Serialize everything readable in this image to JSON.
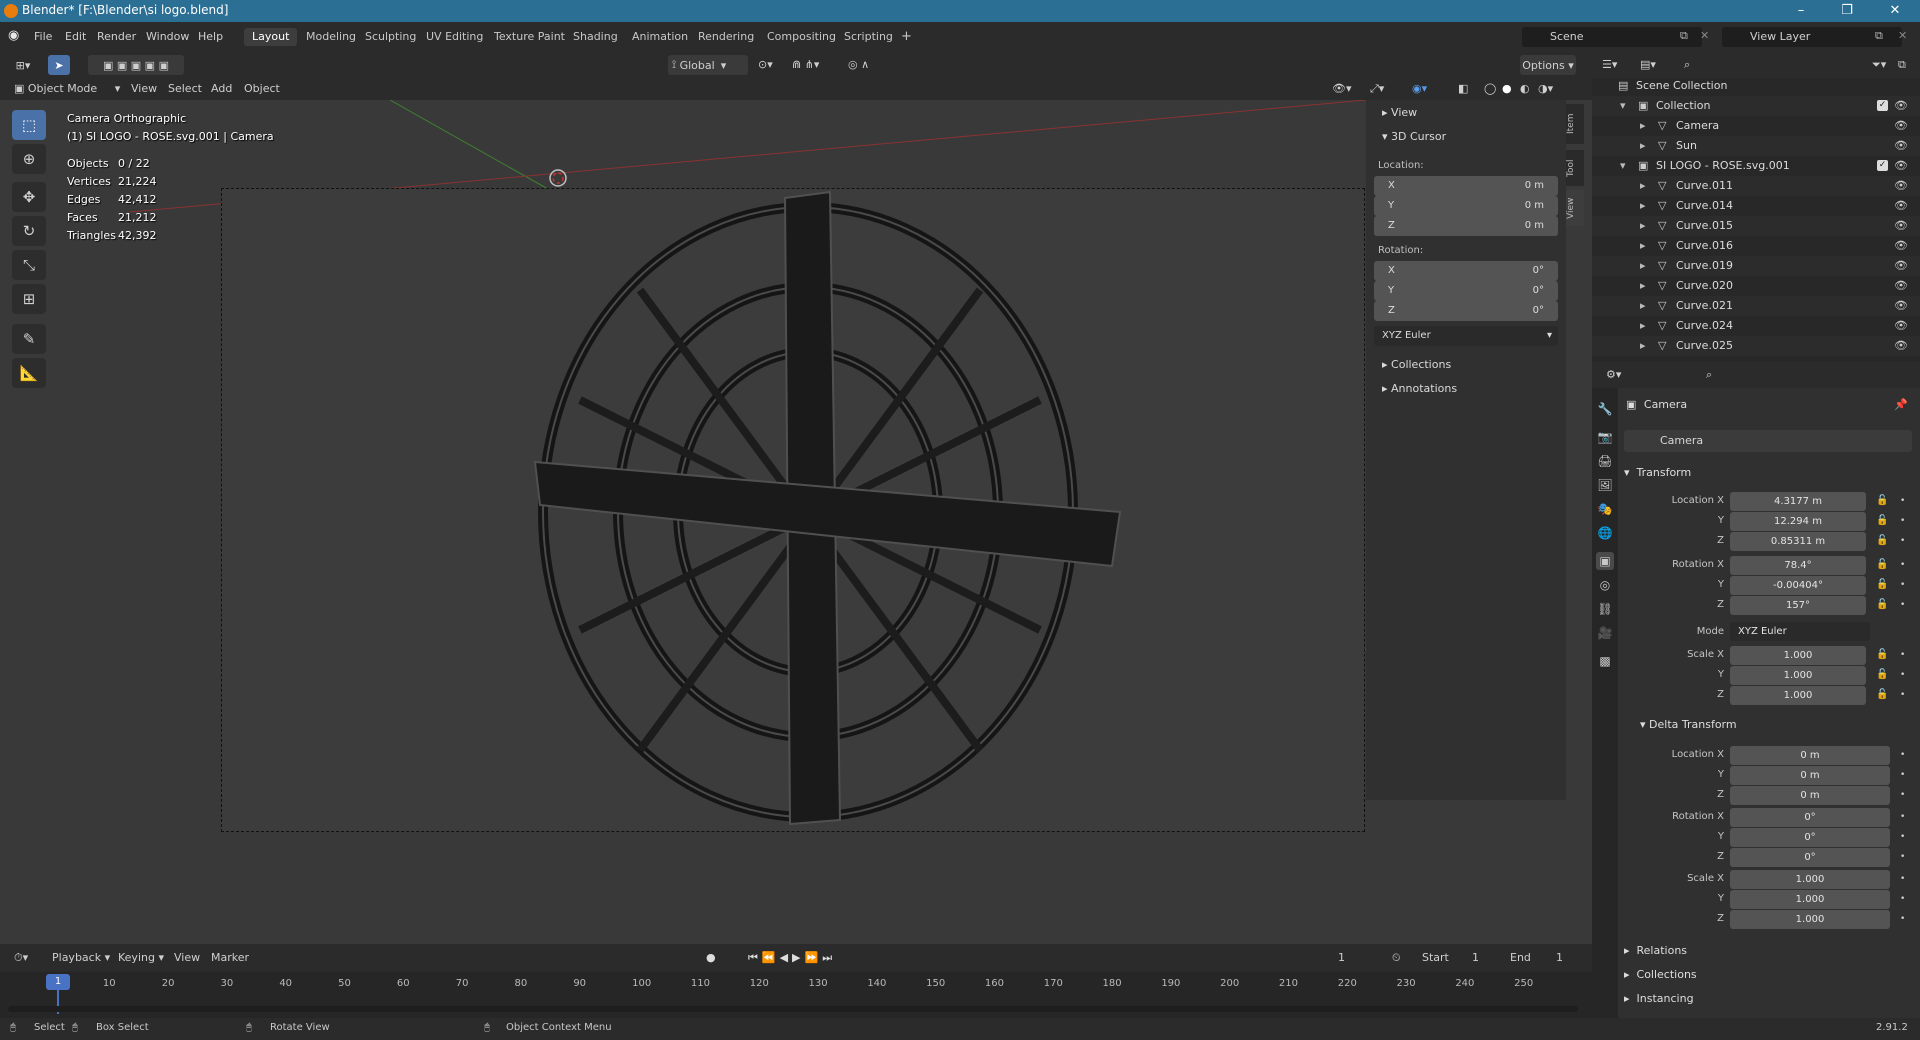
{
  "window": {
    "title": "Blender* [F:\\Blender\\si logo.blend]",
    "min": "–",
    "max": "❐",
    "close": "✕"
  },
  "menu": [
    "File",
    "Edit",
    "Render",
    "Window",
    "Help"
  ],
  "workspaces": [
    "Layout",
    "Modeling",
    "Sculpting",
    "UV Editing",
    "Texture Paint",
    "Shading",
    "Animation",
    "Rendering",
    "Compositing",
    "Scripting"
  ],
  "add_workspace": "+",
  "scene": {
    "label": "Scene",
    "view_layer": "View Layer"
  },
  "vp_header": {
    "transform_orientation": "Global",
    "options": "Options",
    "mode": "Object Mode",
    "menus": [
      "View",
      "Select",
      "Add",
      "Object"
    ]
  },
  "overlay": {
    "line1": "Camera Orthographic",
    "line2": "(1) SI LOGO - ROSE.svg.001 | Camera",
    "stats": [
      {
        "k": "Objects",
        "v": "0 / 22"
      },
      {
        "k": "Vertices",
        "v": "21,224"
      },
      {
        "k": "Edges",
        "v": "42,412"
      },
      {
        "k": "Faces",
        "v": "21,212"
      },
      {
        "k": "Triangles",
        "v": "42,392"
      }
    ]
  },
  "npanel": {
    "view": "View",
    "cursor": "3D Cursor",
    "location_label": "Location:",
    "location": [
      {
        "k": "X",
        "v": "0 m"
      },
      {
        "k": "Y",
        "v": "0 m"
      },
      {
        "k": "Z",
        "v": "0 m"
      }
    ],
    "rotation_label": "Rotation:",
    "rotation": [
      {
        "k": "X",
        "v": "0°"
      },
      {
        "k": "Y",
        "v": "0°"
      },
      {
        "k": "Z",
        "v": "0°"
      }
    ],
    "rot_mode": "XYZ Euler",
    "collections": "Collections",
    "annotations": "Annotations",
    "tabs": [
      "Item",
      "Tool",
      "View"
    ]
  },
  "outliner": {
    "rows": [
      {
        "name": "Scene Collection",
        "indent": 0
      },
      {
        "name": "Collection",
        "indent": 1,
        "expand": "▾",
        "check": true
      },
      {
        "name": "Camera",
        "indent": 2,
        "expand": "▸"
      },
      {
        "name": "Sun",
        "indent": 2,
        "expand": "▸"
      },
      {
        "name": "SI LOGO - ROSE.svg.001",
        "indent": 1,
        "expand": "▾",
        "check": true
      },
      {
        "name": "Curve.011",
        "indent": 2,
        "expand": "▸"
      },
      {
        "name": "Curve.014",
        "indent": 2,
        "expand": "▸"
      },
      {
        "name": "Curve.015",
        "indent": 2,
        "expand": "▸"
      },
      {
        "name": "Curve.016",
        "indent": 2,
        "expand": "▸"
      },
      {
        "name": "Curve.019",
        "indent": 2,
        "expand": "▸"
      },
      {
        "name": "Curve.020",
        "indent": 2,
        "expand": "▸"
      },
      {
        "name": "Curve.021",
        "indent": 2,
        "expand": "▸"
      },
      {
        "name": "Curve.024",
        "indent": 2,
        "expand": "▸"
      },
      {
        "name": "Curve.025",
        "indent": 2,
        "expand": "▸"
      }
    ]
  },
  "props": {
    "object_name": "Camera",
    "data_name": "Camera",
    "transform": "Transform",
    "location": [
      {
        "k": "Location X",
        "v": "4.3177 m"
      },
      {
        "k": "Y",
        "v": "12.294 m"
      },
      {
        "k": "Z",
        "v": "0.85311 m"
      }
    ],
    "rotation": [
      {
        "k": "Rotation X",
        "v": "78.4°"
      },
      {
        "k": "Y",
        "v": "-0.00404°"
      },
      {
        "k": "Z",
        "v": "157°"
      }
    ],
    "mode_label": "Mode",
    "mode": "XYZ Euler",
    "scale": [
      {
        "k": "Scale X",
        "v": "1.000"
      },
      {
        "k": "Y",
        "v": "1.000"
      },
      {
        "k": "Z",
        "v": "1.000"
      }
    ],
    "delta": "Delta Transform",
    "d_location": [
      {
        "k": "Location X",
        "v": "0 m"
      },
      {
        "k": "Y",
        "v": "0 m"
      },
      {
        "k": "Z",
        "v": "0 m"
      }
    ],
    "d_rotation": [
      {
        "k": "Rotation X",
        "v": "0°"
      },
      {
        "k": "Y",
        "v": "0°"
      },
      {
        "k": "Z",
        "v": "0°"
      }
    ],
    "d_scale": [
      {
        "k": "Scale X",
        "v": "1.000"
      },
      {
        "k": "Y",
        "v": "1.000"
      },
      {
        "k": "Z",
        "v": "1.000"
      }
    ],
    "relations": "Relations",
    "collections": "Collections",
    "instancing": "Instancing"
  },
  "timeline": {
    "menus": [
      "Playback",
      "Keying",
      "View",
      "Marker"
    ],
    "current": "1",
    "start_label": "Start",
    "start": "1",
    "end_label": "End",
    "end": "1",
    "ticks": [
      "1",
      "10",
      "20",
      "30",
      "40",
      "50",
      "60",
      "70",
      "80",
      "90",
      "100",
      "110",
      "120",
      "130",
      "140",
      "150",
      "160",
      "170",
      "180",
      "190",
      "200",
      "210",
      "220",
      "230",
      "240",
      "250"
    ]
  },
  "status": {
    "select": "Select",
    "box": "Box Select",
    "rotate": "Rotate View",
    "context": "Object Context Menu",
    "version": "2.91.2"
  }
}
